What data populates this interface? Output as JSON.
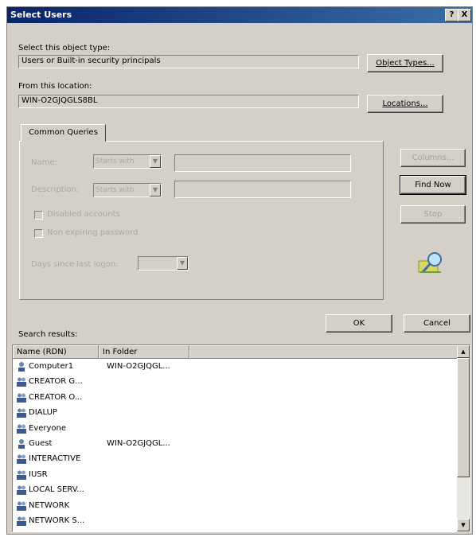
{
  "window": {
    "title": "Select Users",
    "help_btn": "?",
    "close_btn": "X"
  },
  "object_type": {
    "label": "Select this object type:",
    "value": "Users or Built-in security principals",
    "button": "Object Types..."
  },
  "location": {
    "label": "From this location:",
    "value": "WIN-O2GJQGLS8BL",
    "button": "Locations..."
  },
  "queries": {
    "tab": "Common Queries",
    "name_label": "Name:",
    "name_op": "Starts with",
    "desc_label": "Description:",
    "desc_op": "Starts with",
    "disabled_accounts": "Disabled accounts",
    "non_expiring": "Non expiring password",
    "days_label": "Days since last logon:"
  },
  "actions": {
    "columns": "Columns...",
    "find_now": "Find Now",
    "stop": "Stop"
  },
  "dialog": {
    "ok": "OK",
    "cancel": "Cancel"
  },
  "results": {
    "label": "Search results:",
    "columns": [
      "Name (RDN)",
      "In Folder"
    ],
    "rows": [
      {
        "name": "Computer1",
        "folder": "WIN-O2GJQGL...",
        "icon": "user-icon"
      },
      {
        "name": "CREATOR G...",
        "folder": "",
        "icon": "group-icon"
      },
      {
        "name": "CREATOR O...",
        "folder": "",
        "icon": "group-icon"
      },
      {
        "name": "DIALUP",
        "folder": "",
        "icon": "group-icon"
      },
      {
        "name": "Everyone",
        "folder": "",
        "icon": "group-icon"
      },
      {
        "name": "Guest",
        "folder": "WIN-O2GJQGL...",
        "icon": "user-icon"
      },
      {
        "name": "INTERACTIVE",
        "folder": "",
        "icon": "group-icon"
      },
      {
        "name": "IUSR",
        "folder": "",
        "icon": "group-icon"
      },
      {
        "name": "LOCAL SERV...",
        "folder": "",
        "icon": "group-icon"
      },
      {
        "name": "NETWORK",
        "folder": "",
        "icon": "group-icon"
      },
      {
        "name": "NETWORK S...",
        "folder": "",
        "icon": "group-icon"
      }
    ]
  },
  "colors": {
    "title_start": "#0a246a",
    "title_end": "#3a6ea5",
    "face": "#d4d0c8"
  }
}
